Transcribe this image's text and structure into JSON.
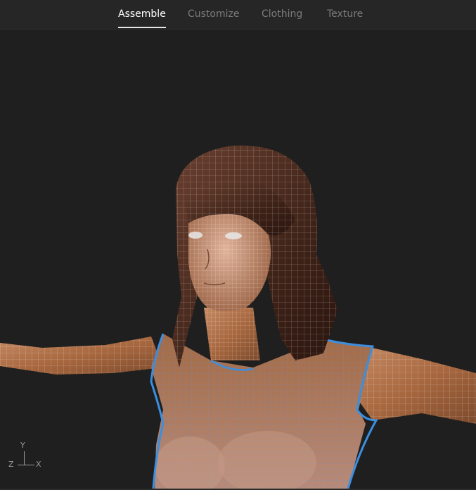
{
  "tabs": [
    {
      "label": "Assemble",
      "active": true
    },
    {
      "label": "Customize",
      "active": false
    },
    {
      "label": "Clothing",
      "active": false
    },
    {
      "label": "Texture",
      "active": false
    }
  ],
  "viewport": {
    "subject": "3d-character-model-wireframe",
    "selection_outline_color": "#3b8fe0",
    "skin_color": "#b0714a",
    "hair_color": "#4a2a1c"
  },
  "axis_gizmo": {
    "y_label": "Y",
    "z_label": "Z",
    "x_label": "X"
  },
  "colors": {
    "background": "#1f1f1f",
    "tabbar": "#262626",
    "tab_active": "#ffffff",
    "tab_inactive": "#7b7b7b"
  }
}
